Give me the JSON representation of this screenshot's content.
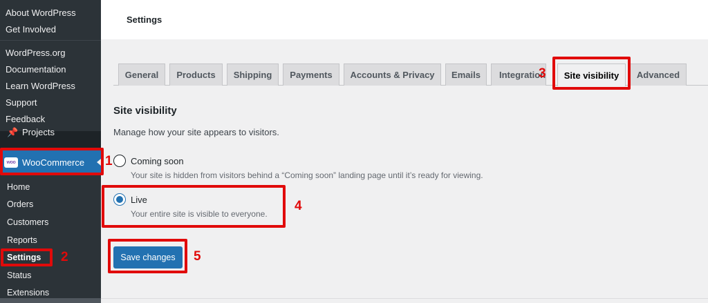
{
  "sidebar": {
    "flyout_top": [
      "About WordPress",
      "Get Involved"
    ],
    "flyout_bottom": [
      "WordPress.org",
      "Documentation",
      "Learn WordPress",
      "Support",
      "Feedback"
    ],
    "projects_label": "Projects",
    "woocommerce": {
      "logo_text": "woo",
      "label": "WooCommerce"
    },
    "submenu": [
      "Home",
      "Orders",
      "Customers",
      "Reports",
      "Settings",
      "Status",
      "Extensions"
    ]
  },
  "header": {
    "title": "Settings"
  },
  "tabs": [
    "General",
    "Products",
    "Shipping",
    "Payments",
    "Accounts & Privacy",
    "Emails",
    "Integration",
    "Site visibility",
    "Advanced"
  ],
  "active_tab": "Site visibility",
  "content": {
    "section_title": "Site visibility",
    "description": "Manage how your site appears to visitors.",
    "options": [
      {
        "label": "Coming soon",
        "description": "Your site is hidden from visitors behind a “Coming soon” landing page until it’s ready for viewing.",
        "checked": false
      },
      {
        "label": "Live",
        "description": "Your entire site is visible to everyone.",
        "checked": true
      }
    ],
    "save_label": "Save changes"
  },
  "annotations": [
    "1",
    "2",
    "3",
    "4",
    "5"
  ],
  "colors": {
    "accent": "#2271b1",
    "annotation": "#e10a0a",
    "sidebar": "#1d2327"
  }
}
